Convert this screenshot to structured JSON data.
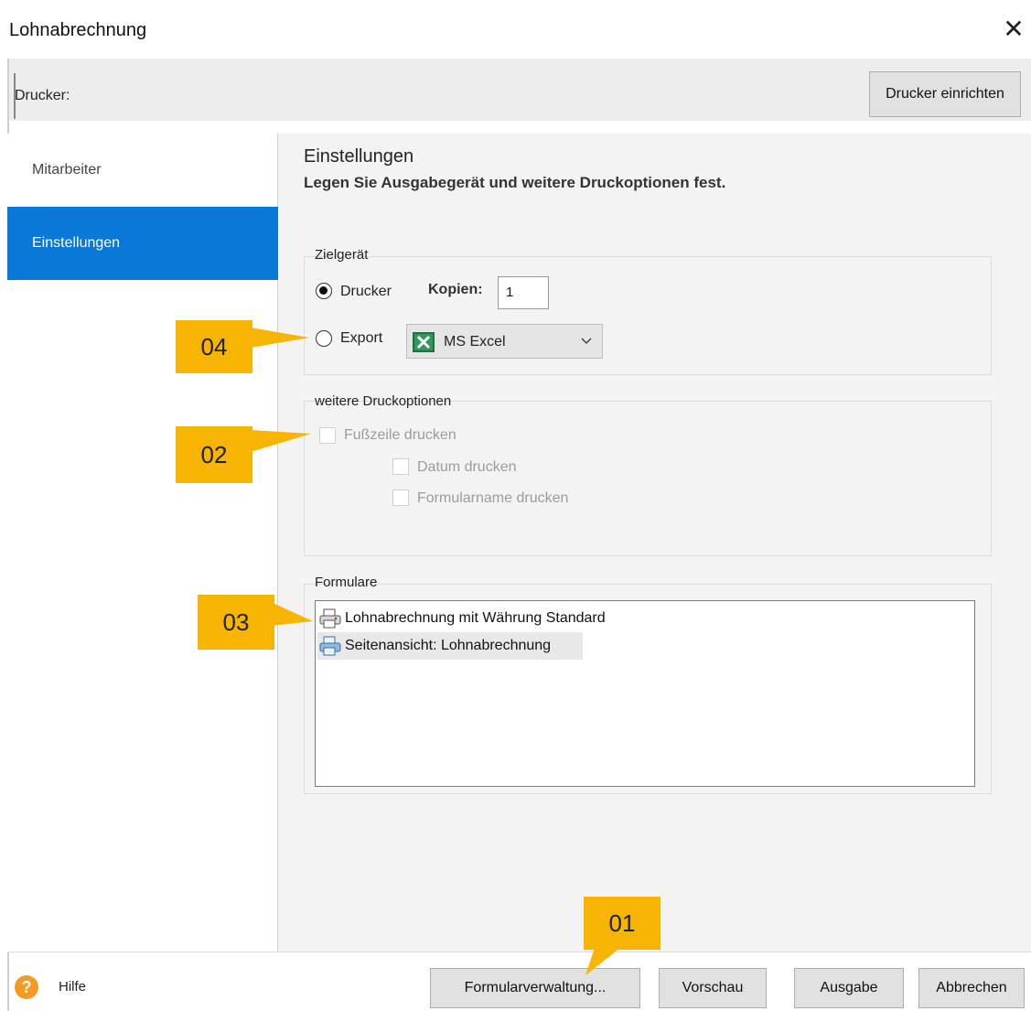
{
  "window": {
    "title": "Lohnabrechnung",
    "close_glyph": "✕"
  },
  "printer": {
    "label": "Drucker:",
    "setup_button": "Drucker einrichten"
  },
  "sidebar": {
    "items": [
      {
        "label": "Mitarbeiter",
        "selected": false
      },
      {
        "label": "Einstellungen",
        "selected": true
      }
    ]
  },
  "main": {
    "heading": "Einstellungen",
    "subheading": "Legen Sie Ausgabegerät und weitere Druckoptionen fest.",
    "target": {
      "legend": "Zielgerät",
      "printer_option": "Drucker",
      "copies_label": "Kopien:",
      "copies_value": "1",
      "export_option": "Export",
      "export_format": "MS Excel",
      "selected": "Drucker"
    },
    "print_options": {
      "legend": "weitere Druckoptionen",
      "footer": "Fußzeile drucken",
      "date": "Datum drucken",
      "form_name": "Formularname drucken"
    },
    "forms": {
      "legend": "Formulare",
      "items": [
        {
          "label": "Lohnabrechnung mit Währung Standard",
          "icon": "printer-form-icon"
        },
        {
          "label": "Seitenansicht: Lohnabrechnung",
          "icon": "print-preview-icon"
        }
      ]
    }
  },
  "footer": {
    "help": "Hilfe",
    "buttons": {
      "forms_manager": "Formularverwaltung...",
      "preview": "Vorschau",
      "output": "Ausgabe",
      "cancel": "Abbrechen"
    }
  },
  "callouts": [
    "01",
    "02",
    "03",
    "04"
  ],
  "colors": {
    "accent": "#0a78d7",
    "callout": "#f7b400",
    "help": "#f39c21"
  }
}
